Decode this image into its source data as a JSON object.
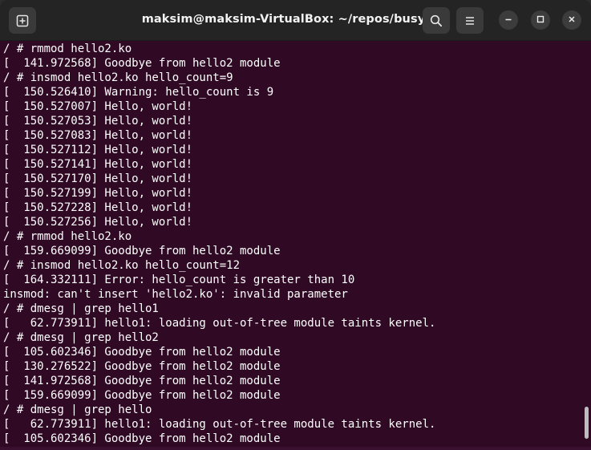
{
  "window": {
    "title": "maksim@maksim-VirtualBox: ~/repos/busybox"
  },
  "icons": {
    "new_tab": "new-tab-icon",
    "search": "search-icon",
    "menu": "hamburger-menu-icon",
    "minimize": "minimize-icon",
    "maximize": "maximize-icon",
    "close": "close-icon"
  },
  "colors": {
    "terminal_bg": "#300a24",
    "titlebar_bg": "#242424",
    "text": "#ffffff"
  },
  "terminal": {
    "lines": [
      "/ # rmmod hello2.ko",
      "[  141.972568] Goodbye from hello2 module",
      "/ # insmod hello2.ko hello_count=9",
      "[  150.526410] Warning: hello_count is 9",
      "[  150.527007] Hello, world!",
      "[  150.527053] Hello, world!",
      "[  150.527083] Hello, world!",
      "[  150.527112] Hello, world!",
      "[  150.527141] Hello, world!",
      "[  150.527170] Hello, world!",
      "[  150.527199] Hello, world!",
      "[  150.527228] Hello, world!",
      "[  150.527256] Hello, world!",
      "/ # rmmod hello2.ko",
      "[  159.669099] Goodbye from hello2 module",
      "/ # insmod hello2.ko hello_count=12",
      "[  164.332111] Error: hello_count is greater than 10",
      "insmod: can't insert 'hello2.ko': invalid parameter",
      "/ # dmesg | grep hello1",
      "[   62.773911] hello1: loading out-of-tree module taints kernel.",
      "/ # dmesg | grep hello2",
      "[  105.602346] Goodbye from hello2 module",
      "[  130.276522] Goodbye from hello2 module",
      "[  141.972568] Goodbye from hello2 module",
      "[  159.669099] Goodbye from hello2 module",
      "/ # dmesg | grep hello",
      "[   62.773911] hello1: loading out-of-tree module taints kernel.",
      "[  105.602346] Goodbye from hello2 module"
    ]
  }
}
